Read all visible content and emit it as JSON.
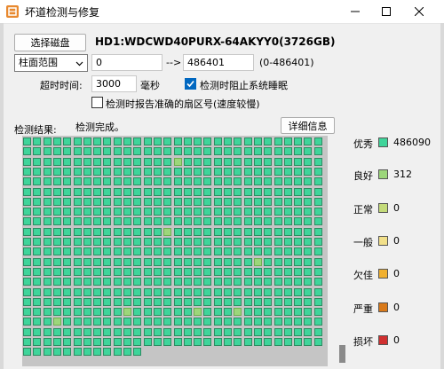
{
  "window": {
    "title": "坏道检测与修复"
  },
  "toolbar": {
    "select_disk_label": "选择磁盘",
    "disk_name": "HD1:WDCWD40PURX-64AKYY0(3726GB)"
  },
  "range": {
    "mode_selected": "柱面范围",
    "start_value": "0",
    "arrow_text": "-->",
    "end_value": "486401",
    "range_hint": "(0-486401)"
  },
  "timeout": {
    "label": "超时时间:",
    "value": "3000",
    "unit": "毫秒"
  },
  "options": {
    "prevent_sleep_label": "检测时阻止系统睡眠",
    "prevent_sleep_checked": true,
    "report_sector_label": "检测时报告准确的扇区号(速度较慢)",
    "report_sector_checked": false
  },
  "results": {
    "label": "检测结果:",
    "status": "检测完成。",
    "details_button": "详细信息"
  },
  "legend": [
    {
      "label": "优秀",
      "count": "486090",
      "color": "#3fd49a"
    },
    {
      "label": "良好",
      "count": "312",
      "color": "#9cd67a"
    },
    {
      "label": "正常",
      "count": "0",
      "color": "#c4db7a"
    },
    {
      "label": "一般",
      "count": "0",
      "color": "#f2e08a"
    },
    {
      "label": "欠佳",
      "count": "0",
      "color": "#f0b030"
    },
    {
      "label": "严重",
      "count": "0",
      "color": "#d97a1a"
    },
    {
      "label": "损坏",
      "count": "0",
      "color": "#d03030"
    }
  ],
  "colors": {
    "excellent": "#3fd49a",
    "good": "#9cd67a",
    "grid_background": "#c5c5c5"
  },
  "grid": {
    "good_blocks": [
      [
        15,
        2
      ],
      [
        14,
        9
      ],
      [
        23,
        12
      ],
      [
        3,
        18
      ],
      [
        10,
        17
      ],
      [
        17,
        17
      ],
      [
        21,
        17
      ]
    ]
  },
  "icons": {
    "app": "app-logo-icon",
    "minimize": "minimize-icon",
    "maximize": "maximize-icon",
    "close": "close-icon",
    "dropdown": "chevron-down-icon",
    "check": "checkmark-icon"
  }
}
